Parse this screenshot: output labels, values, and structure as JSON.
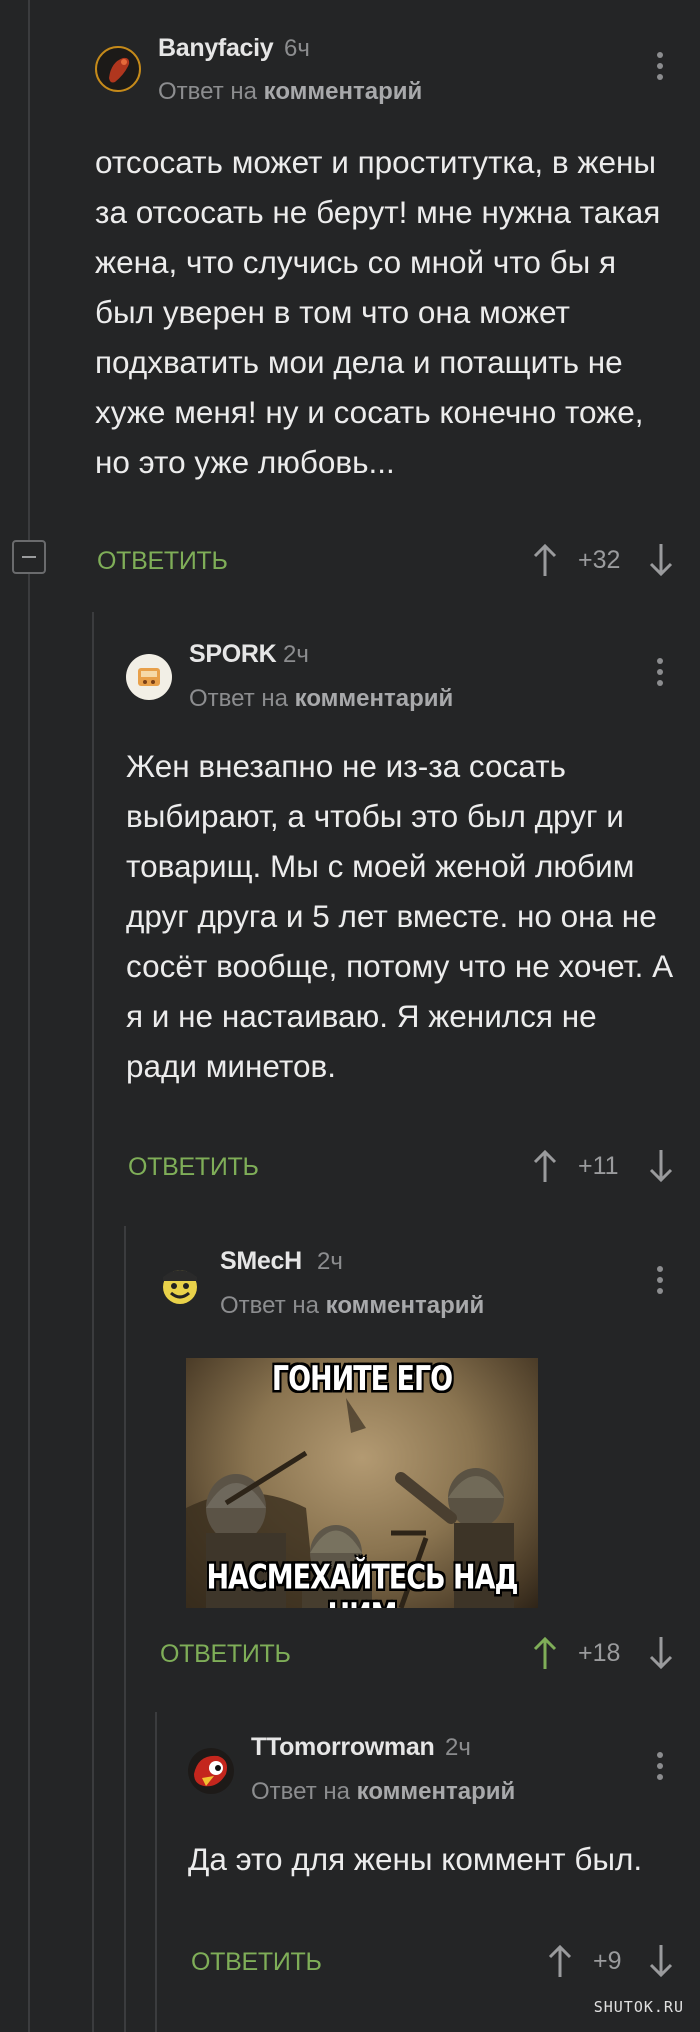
{
  "comments": [
    {
      "username": "Banyfaciy",
      "time": "6ч",
      "reply_prefix": "Ответ на",
      "reply_target": "комментарий",
      "text": "отсосать может и проститутка, в жены за отсосать не берут! мне нужна такая жена, что случись со мной что бы я был уверен в том что она может подхватить мои дела и потащить не хуже меня! ну и сосать конечно тоже, но это уже любовь...",
      "reply_label": "ОТВЕТИТЬ",
      "score": "+32"
    },
    {
      "username": "SPORK",
      "time": "2ч",
      "reply_prefix": "Ответ на",
      "reply_target": "комментарий",
      "text": "Жен внезапно не из-за сосать выбирают, а чтобы это был друг и товарищ. Мы с моей женой любим друг друга и 5 лет вместе. но она не сосёт вообще, потому что не хочет. А я и не настаиваю.  Я женился не ради минетов.",
      "reply_label": "ОТВЕТИТЬ",
      "score": "+11"
    },
    {
      "username": "SMecH",
      "time": "2ч",
      "reply_prefix": "Ответ на",
      "reply_target": "комментарий",
      "meme_top": "ГОНИТЕ ЕГО",
      "meme_bottom": "НАСМЕХАЙТЕСЬ НАД НИМ",
      "reply_label": "ОТВЕТИТЬ",
      "score": "+18",
      "upvoted": true
    },
    {
      "username": "TTomorrowman",
      "time": "2ч",
      "reply_prefix": "Ответ на",
      "reply_target": "комментарий",
      "text": "Да это для жены коммент был.",
      "reply_label": "ОТВЕТИТЬ",
      "score": "+9"
    }
  ],
  "colors": {
    "background": "#242526",
    "accent_green": "#7fae58",
    "muted": "#8c8d8f"
  },
  "watermark": "SHUTOK.RU"
}
